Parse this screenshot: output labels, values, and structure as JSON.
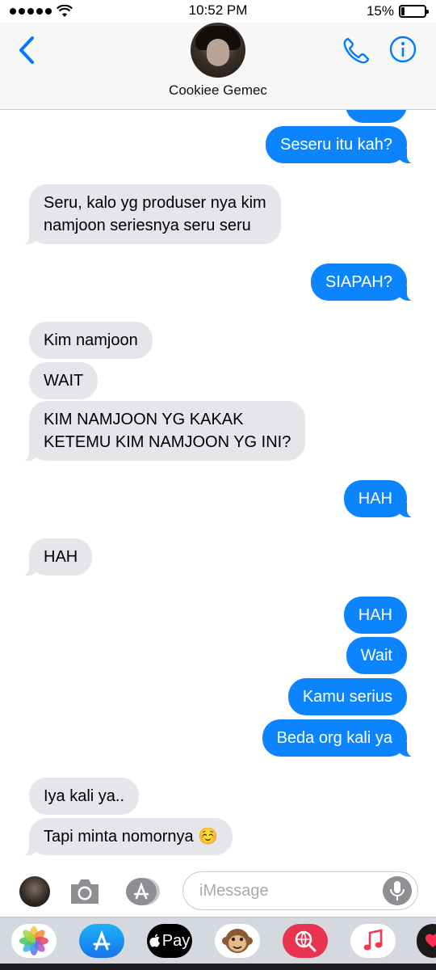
{
  "status_bar": {
    "time": "10:52 PM",
    "battery": "15%",
    "battery_level": 0.15
  },
  "header": {
    "contact_name": "Cookiee Gemec",
    "back_icon": "chevron-left-icon",
    "call_icon": "phone-icon",
    "info_icon": "info-icon"
  },
  "messages": [
    {
      "from": "me",
      "text": "Seseru itu kah?"
    },
    {
      "from": "them",
      "lines": [
        "Seru, kalo yg produser nya kim",
        "namjoon seriesnya seru seru"
      ]
    },
    {
      "from": "me",
      "text": "SIAPAH?"
    },
    {
      "from": "them",
      "text": "Kim namjoon"
    },
    {
      "from": "them",
      "text": "WAIT"
    },
    {
      "from": "them",
      "lines": [
        "KIM NAMJOON YG KAKAK",
        "KETEMU KIM NAMJOON YG INI?"
      ]
    },
    {
      "from": "me",
      "text": "HAH"
    },
    {
      "from": "them",
      "text": "HAH"
    },
    {
      "from": "me",
      "text": "HAH"
    },
    {
      "from": "me",
      "text": "Wait"
    },
    {
      "from": "me",
      "text": "Kamu serius"
    },
    {
      "from": "me",
      "text": "Beda org kali ya"
    },
    {
      "from": "them",
      "text": "Iya kali ya.."
    },
    {
      "from": "them",
      "text": "Tapi minta nomornya ☺️"
    }
  ],
  "input_bar": {
    "placeholder": "iMessage",
    "camera_icon": "camera-icon",
    "apps_icon": "app-store-icon",
    "mic_icon": "microphone-icon"
  },
  "app_drawer": {
    "apple_pay_label": "Pay",
    "apps": [
      "photos-icon",
      "app-store-icon",
      "apple-pay-icon",
      "animoji-monkey-icon",
      "web-search-icon",
      "music-icon",
      "heart-icon"
    ]
  },
  "colors": {
    "outgoing": "#0b84fe",
    "incoming": "#e5e5ea",
    "accent": "#007aff"
  }
}
